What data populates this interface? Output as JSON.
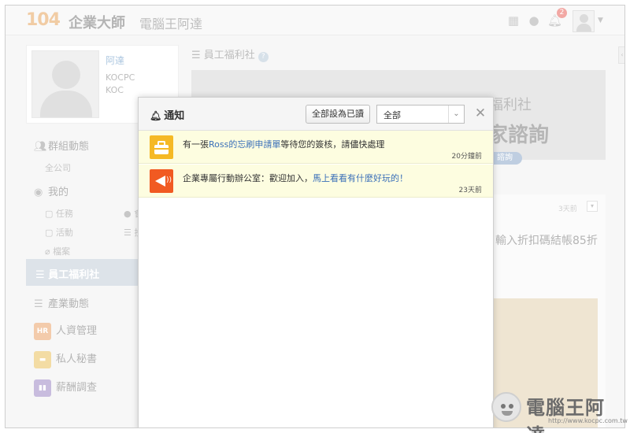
{
  "header": {
    "logo_number": "104",
    "logo_text": "企業大師",
    "site_name": "電腦王阿達",
    "notification_count": "2"
  },
  "sidebar": {
    "profile": {
      "name": "阿達",
      "line1": "KOCPC",
      "line2": "KOC"
    },
    "group_activity": "群組動態",
    "company": "全公司",
    "mine": "我的",
    "sub_items": [
      "任務",
      "活動",
      "檔案"
    ],
    "sub_items_right": [
      "會",
      "投"
    ],
    "active_item": "員工福利社",
    "industry": "產業動態",
    "apps": [
      {
        "label": "人資管理",
        "icon_text": "HR",
        "color": "#e9a066"
      },
      {
        "label": "私人秘書",
        "icon_text": "",
        "color": "#e9bf5a"
      },
      {
        "label": "薪酬調查",
        "icon_text": "",
        "color": "#9b86c4"
      }
    ]
  },
  "main": {
    "title": "員工福利社",
    "banner_line1": "福利社",
    "banner_line2": "家諮詢",
    "banner_pill": "諮詢",
    "card_time": "3天前",
    "card_text": "輸入折扣碼結帳85折"
  },
  "notifications_modal": {
    "title": "通知",
    "mark_all_read": "全部設為已讀",
    "filter_value": "全部",
    "items": [
      {
        "text_before": "有一張",
        "link1": "Ross的忘刷申請單",
        "text_after": "等待您的簽核，請儘快處理",
        "time": "20分鐘前",
        "icon": "briefcase-icon"
      },
      {
        "text_before": "企業專屬行動辦公室：歡迎加入，",
        "link1": "馬上看看有什麼好玩的！",
        "text_after": "",
        "time": "23天前",
        "icon": "megaphone-icon"
      }
    ]
  },
  "watermark": {
    "title": "電腦王阿達",
    "url": "http://www.kocpc.com.tw"
  }
}
